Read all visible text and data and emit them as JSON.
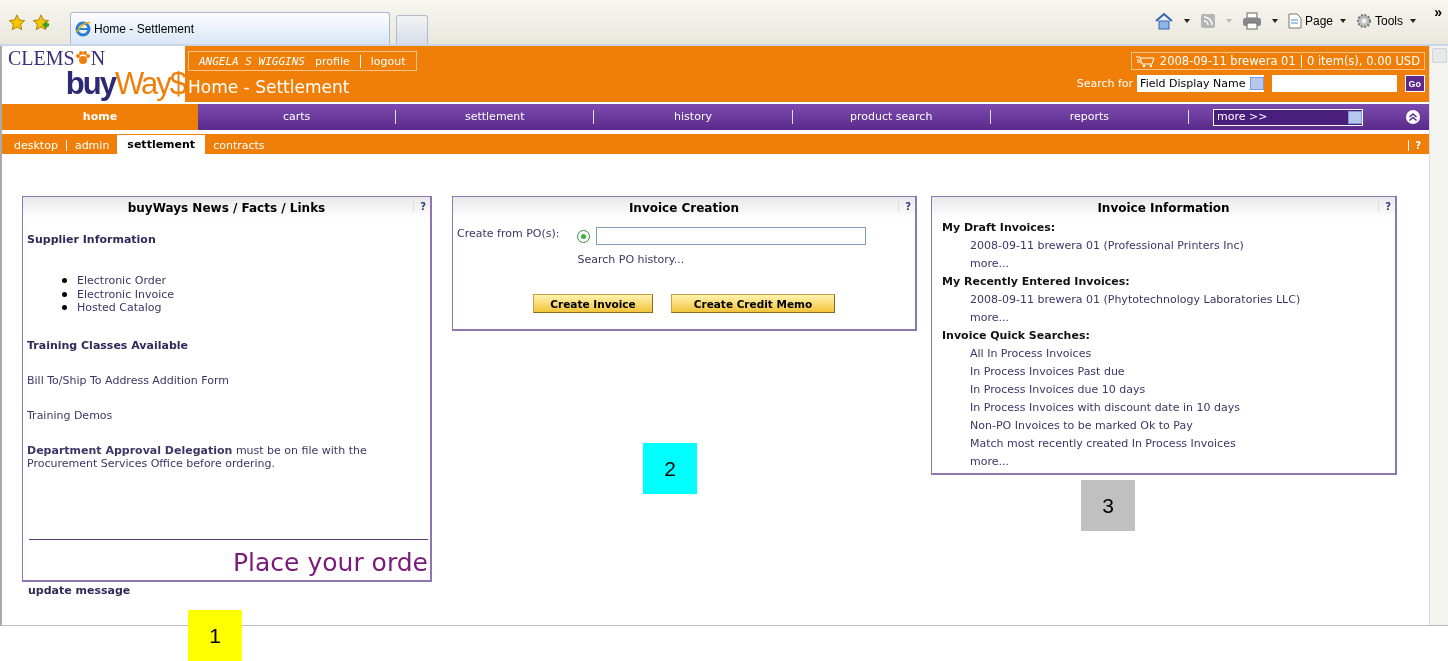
{
  "browser": {
    "tab_title": "Home - Settlement",
    "toolbar": [
      {
        "kind": "home"
      },
      {
        "kind": "feed"
      },
      {
        "kind": "print"
      },
      {
        "kind": "page",
        "label": "Page"
      },
      {
        "kind": "tools",
        "label": "Tools"
      }
    ],
    "overflow": "»"
  },
  "header": {
    "logo": {
      "top_left": "CLEMS",
      "top_right": "N",
      "word_1": "buy",
      "word_2": "Way$"
    },
    "user": {
      "name": "ANGELA S WIGGINS",
      "links": [
        "profile",
        "logout"
      ]
    },
    "page_title": "Home - Settlement",
    "cart": "2008-09-11 brewera 01 | 0 item(s), 0.00 USD",
    "search": {
      "label": "Search for",
      "field": "Field Display Name",
      "button": "Go"
    }
  },
  "nav": {
    "items": [
      {
        "label": "home",
        "selected": true
      },
      {
        "label": "carts",
        "selected": false
      },
      {
        "label": "settlement",
        "selected": false
      },
      {
        "label": "history",
        "selected": false
      },
      {
        "label": "product search",
        "selected": false
      },
      {
        "label": "reports",
        "selected": false
      }
    ],
    "more": "more >>"
  },
  "subnav": {
    "items": [
      {
        "label": "desktop",
        "selected": false
      },
      {
        "label": "admin",
        "selected": false
      },
      {
        "label": "settlement",
        "selected": true
      },
      {
        "label": "contracts",
        "selected": false
      }
    ],
    "help": "?"
  },
  "news_panel": {
    "title": "buyWays News / Facts / Links",
    "help": "?",
    "blocks": [
      {
        "kind": "heading",
        "text": "Supplier Information"
      },
      {
        "kind": "list",
        "items": [
          "Electronic Order",
          "Electronic Invoice",
          "Hosted Catalog"
        ]
      },
      {
        "kind": "heading",
        "text": "Training Classes Available"
      },
      {
        "kind": "link",
        "text": "Bill To/Ship To Address Addition Form"
      },
      {
        "kind": "link",
        "text": "Training Demos"
      },
      {
        "kind": "paragraph",
        "text": "**Department Approval Delegation** must be on file with the Procurement Services Office before ordering."
      }
    ],
    "banner": "Place your orde",
    "footer": "update message"
  },
  "creation_panel": {
    "title": "Invoice Creation",
    "help": "?",
    "label": "Create from PO(s):",
    "radio_selected": true,
    "link": "Search PO history...",
    "buttons": [
      "Create Invoice",
      "Create Credit Memo"
    ]
  },
  "info_panel": {
    "title": "Invoice Information",
    "help": "?",
    "groups": [
      {
        "heading": "My Draft Invoices:",
        "links": [
          "2008-09-11 brewera 01 (Professional Printers Inc)",
          "more..."
        ]
      },
      {
        "heading": "My Recently Entered Invoices:",
        "links": [
          "2008-09-11 brewera 01 (Phytotechnology Laboratories LLC)",
          "more..."
        ]
      },
      {
        "heading": "Invoice Quick Searches:",
        "links": [
          "All In Process Invoices",
          "In Process Invoices Past due",
          "In Process Invoices due 10 days",
          "In Process Invoices with discount date in 10 days",
          "Non-PO Invoices to be marked Ok to Pay",
          "Match most recently created In Process Invoices",
          "more..."
        ]
      }
    ]
  },
  "markers": [
    {
      "label": "1",
      "color": "#ffff00"
    },
    {
      "label": "2",
      "color": "#00ffff"
    },
    {
      "label": "3",
      "color": "#c0c0c0"
    }
  ]
}
